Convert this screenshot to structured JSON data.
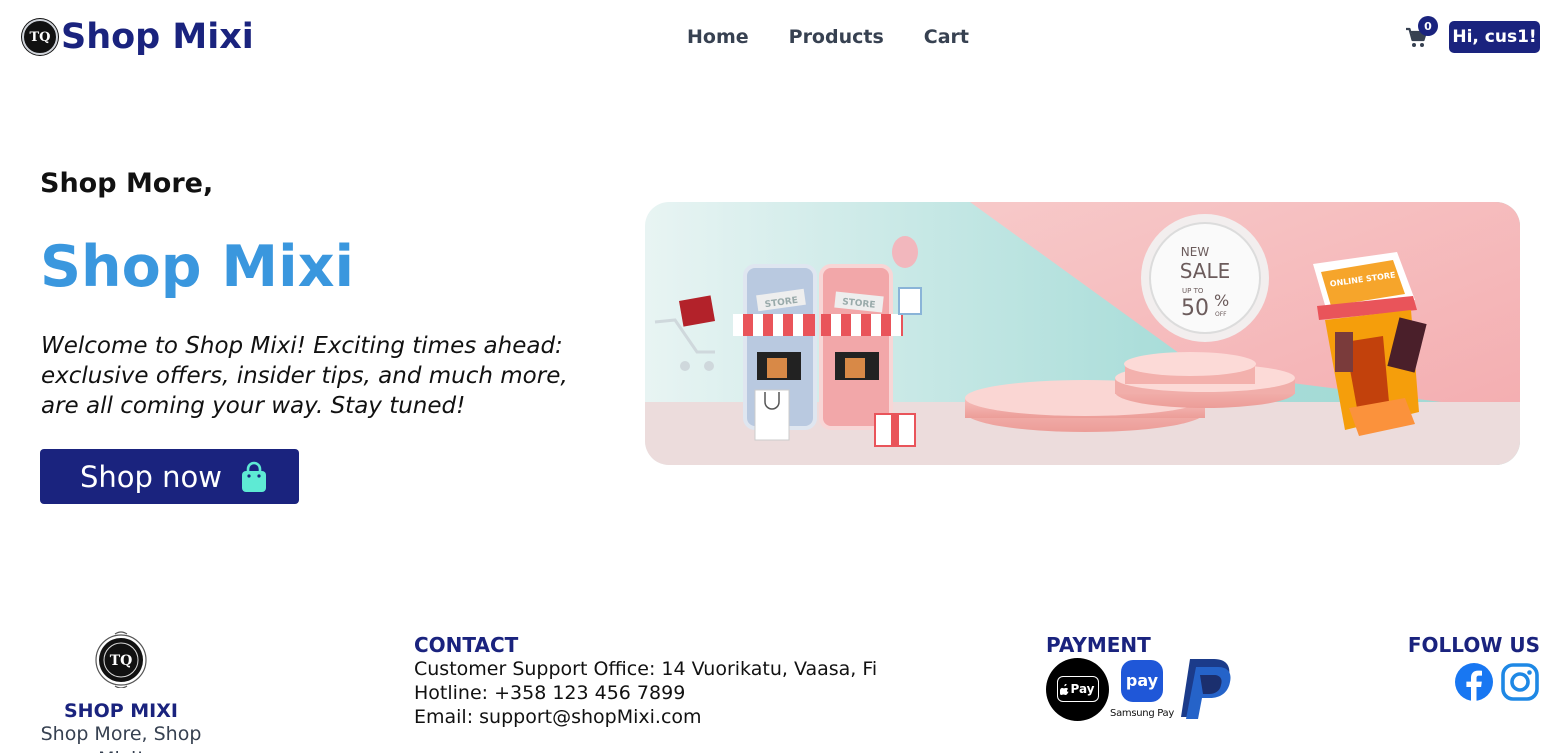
{
  "header": {
    "brand_name": "Shop Mixi",
    "logo_text": "TQ",
    "nav": [
      {
        "label": "Home"
      },
      {
        "label": "Products"
      },
      {
        "label": "Cart"
      }
    ],
    "cart_count": "0",
    "user_greeting": "Hi, cus1!"
  },
  "hero": {
    "kicker": "Shop More,",
    "title": "Shop Mixi",
    "text": "Welcome to Shop Mixi! Exciting times ahead: exclusive offers, insider tips, and much more, are all coming your way. Stay tuned!",
    "button_label": "Shop now",
    "banner": {
      "store_left": "STORE",
      "store_right": "STORE",
      "sale_new": "NEW",
      "sale_word": "SALE",
      "sale_upto": "UP TO",
      "sale_amount": "50",
      "sale_percent": "%",
      "sale_off": "OFF",
      "online_store": "ONLINE STORE"
    }
  },
  "footer": {
    "brand_name": "SHOP MIXI",
    "tagline": "Shop More, Shop Mixi!",
    "logo_text": "TQ",
    "contact": {
      "heading": "CONTACT",
      "office": "Customer Support Office: 14 Vuorikatu, Vaasa, Fi",
      "hotline": "Hotline: +358 123 456 7899",
      "email": "Email: support@shopMixi.com"
    },
    "payment": {
      "heading": "PAYMENT",
      "apple_pay": "Pay",
      "samsung_pay_badge": "pay",
      "samsung_pay_label": "Samsung Pay"
    },
    "follow": {
      "heading": "FOLLOW US"
    }
  },
  "colors": {
    "brand_navy": "#1a237e",
    "hero_blue": "#3a97de",
    "bag_green": "#5eead4",
    "facebook_blue": "#1877f2",
    "instagram_blue": "#1e88e5"
  },
  "icons": [
    "cart-icon",
    "shopping-bag-icon",
    "facebook-icon",
    "instagram-icon",
    "apple-pay-icon",
    "samsung-pay-icon",
    "paypal-icon"
  ]
}
